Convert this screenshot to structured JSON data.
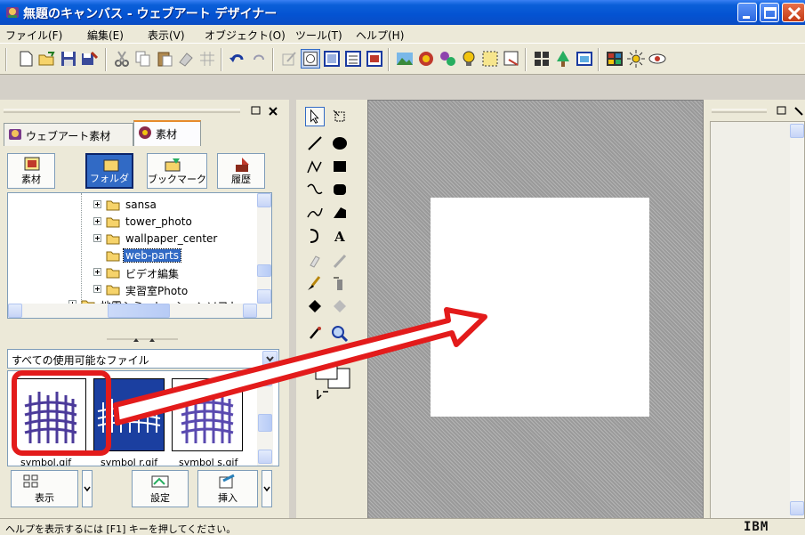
{
  "window": {
    "title": "無題のキャンバス - ウェブアート デザイナー",
    "title_bar_color": "#0a5fd8",
    "buttons": [
      "minimize-icon",
      "maximize-icon",
      "close-icon"
    ]
  },
  "menu": [
    "ファイル(F)",
    "編集(E)",
    "表示(V)",
    "オブジェクト(O)",
    "ツール(T)",
    "ヘルプ(H)"
  ],
  "toolbar": {
    "icons": [
      "new-icon",
      "open-icon",
      "save-icon",
      "save-as-icon",
      "cut-icon",
      "copy-icon",
      "paste-icon",
      "erase-icon",
      "grid-icon",
      "undo-icon",
      "redo-icon",
      "edit-icon",
      "frame-icon",
      "canvas-icon",
      "list-icon",
      "image-window-icon",
      "image-icon",
      "wizard-icon",
      "stamp-icon",
      "bulb-icon",
      "select-object-icon",
      "export-icon",
      "arrange-icon",
      "tree-icon",
      "image-view-icon",
      "color-icon",
      "sun-icon",
      "eye-icon"
    ]
  },
  "left_panel": {
    "tabs": [
      "ウェブアート素材",
      "素材"
    ],
    "active_tab": "素材",
    "buttons": [
      "素材",
      "フォルダ",
      "ブックマーク",
      "履歴"
    ],
    "active_button": "フォルダ",
    "tree": {
      "items": [
        "sansa",
        "tower_photo",
        "wallpaper_center",
        "web-parts",
        "ビデオ編集",
        "実習室Photo",
        "地震シミュレーションソフト"
      ],
      "selected": "web-parts"
    },
    "filter": "すべての使用可能なファイル",
    "thumbnails": [
      "symbol.gif",
      "symbol r.gif",
      "symbol s.gif"
    ],
    "bottom_buttons": [
      "表示",
      "設定",
      "挿入"
    ]
  },
  "colors": {
    "selection": "#316ac5",
    "highlight": "#e31b1b",
    "thumb_blue": "#1b3fa0",
    "thumb_purple": "#4b3a9a"
  },
  "status": {
    "text": "ヘルプを表示するには [F1] キーを押してください。",
    "brand": "IBM"
  }
}
